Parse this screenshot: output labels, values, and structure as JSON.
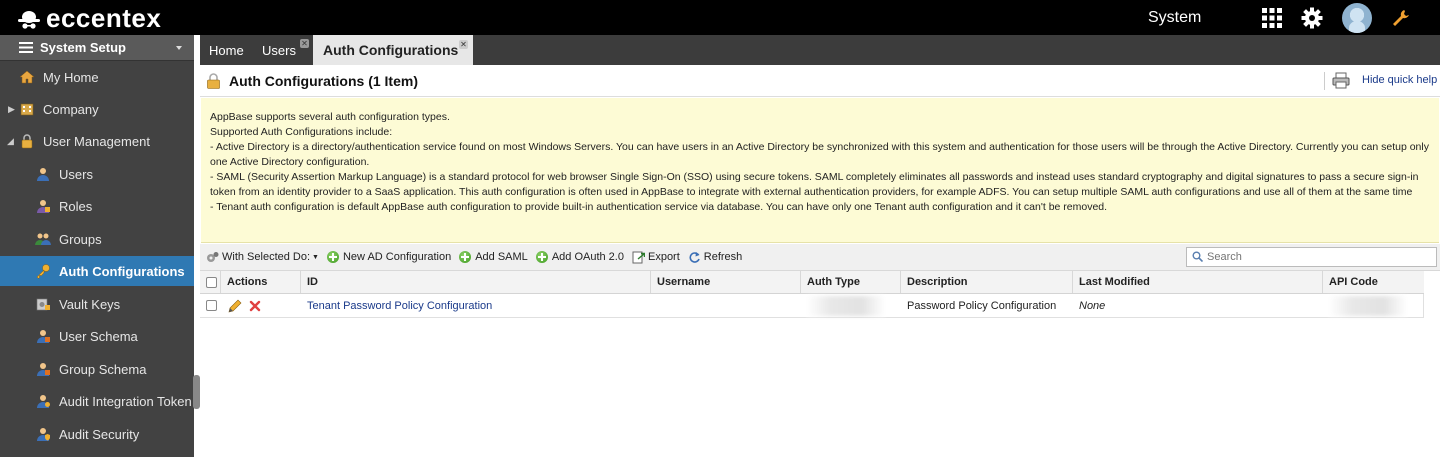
{
  "brand": {
    "name": "eccentex"
  },
  "topbar": {
    "context_label": "System"
  },
  "sidebar": {
    "header": "System Setup",
    "items": [
      {
        "label": "My Home"
      },
      {
        "label": "Company"
      },
      {
        "label": "User Management"
      },
      {
        "label": "Users"
      },
      {
        "label": "Roles"
      },
      {
        "label": "Groups"
      },
      {
        "label": "Auth Configurations"
      },
      {
        "label": "Vault Keys"
      },
      {
        "label": "User Schema"
      },
      {
        "label": "Group Schema"
      },
      {
        "label": "Audit Integration Token"
      },
      {
        "label": "Audit Security"
      }
    ]
  },
  "tabs": [
    {
      "label": "Home"
    },
    {
      "label": "Users"
    },
    {
      "label": "Auth Configurations"
    }
  ],
  "page": {
    "title": "Auth Configurations (1 Item)",
    "hide_help": "Hide quick help"
  },
  "help": {
    "lines": [
      "AppBase supports several auth configuration types.",
      "Supported Auth Configurations include:",
      "- Active Directory is a directory/authentication service found on most Windows Servers. You can have users in an Active Directory be synchronized with this system and authentication for those users will be through the Active Directory. Currently you can setup only one Active Directory configuration.",
      "- SAML (Security Assertion Markup Language) is a standard protocol for web browser Single Sign-On (SSO) using secure tokens. SAML completely eliminates all passwords and instead uses standard cryptography and digital signatures to pass a secure sign-in token from an identity provider to a SaaS application. This auth configuration is often used in AppBase to integrate with external authentication providers, for example ADFS. You can setup multiple SAML auth configurations and use all of them at the same time",
      "- Tenant auth configuration is default AppBase auth configuration to provide built-in authentication service via database. You can have only one Tenant auth configuration and it can't be removed."
    ]
  },
  "toolbar": {
    "with_selected": "With Selected Do:",
    "new_ad": "New AD Configuration",
    "add_saml": "Add SAML",
    "add_oauth": "Add OAuth 2.0",
    "export": "Export",
    "refresh": "Refresh",
    "search_placeholder": "Search"
  },
  "grid": {
    "columns": [
      "Actions",
      "ID",
      "Username",
      "Auth Type",
      "Description",
      "Last Modified",
      "API Code"
    ],
    "rows": [
      {
        "id": "Tenant Password Policy Configuration",
        "username": "",
        "description": "Password Policy Configuration",
        "last_modified": "None"
      }
    ]
  },
  "colors": {
    "accent": "#2f79b3",
    "sidebar_bg": "#424242",
    "topbar_bg": "#000000",
    "help_bg": "#fdfbd5"
  }
}
